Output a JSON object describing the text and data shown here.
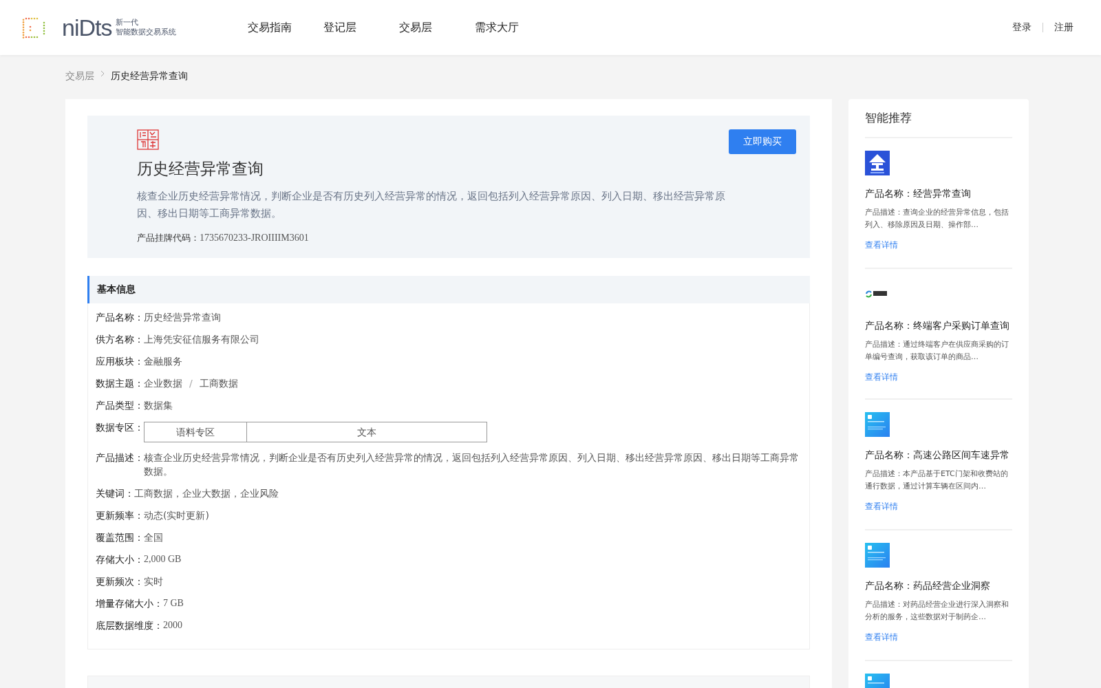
{
  "header": {
    "logo_text": "niDts",
    "logo_tagline": [
      "新一代",
      "智能数据交易系统"
    ],
    "nav": [
      {
        "label": "交易指南",
        "selected": false
      },
      {
        "label": "登记层",
        "selected": false
      },
      {
        "label": "交易层",
        "selected": false
      },
      {
        "label": "需求大厅",
        "selected": false
      }
    ],
    "auth": [
      "登录",
      "注册"
    ]
  },
  "breadcrumb": [
    "交易层",
    "历史经营异常查询"
  ],
  "product": {
    "title": "历史经营异常查询",
    "description": "核查企业历史经营异常情况，判断企业是否有历史列入经营异常的情况，返回包括列入经营异常原因、列入日期、移出经营异常原因、移出日期等工商异常数据。",
    "code_label": "产品挂牌代码：",
    "code": "1735670233-JROIIIIM3601",
    "buy_button": "立即购买"
  },
  "basic_info": {
    "title": "基本信息",
    "fields": [
      {
        "kind": "text",
        "label": "产品名称：",
        "value": "历史经营异常查询"
      },
      {
        "kind": "text",
        "label": "供方名称：",
        "value": "上海凭安征信服务有限公司"
      },
      {
        "kind": "text",
        "label": "应用板块：",
        "value": "金融服务"
      },
      {
        "kind": "path",
        "label": "数据主题：",
        "separator": "/",
        "values": [
          "企业数据",
          "工商数据"
        ]
      },
      {
        "kind": "text",
        "label": "产品类型：",
        "value": "数据集"
      },
      {
        "kind": "table",
        "label": "数据专区：",
        "values": [
          "语料专区",
          "文本"
        ]
      },
      {
        "kind": "text",
        "label": "产品描述：",
        "value": "核查企业历史经营异常情况，判断企业是否有历史列入经营异常的情况，返回包括列入经营异常原因、列入日期、移出经营异常原因、移出日期等工商异常数据。"
      },
      {
        "kind": "text",
        "label": "关键词：",
        "value": "工商数据，企业大数据，企业风险"
      },
      {
        "kind": "text",
        "label": "更新频率：",
        "value": "动态(实时更新)"
      },
      {
        "kind": "text",
        "label": "覆盖范围：",
        "value": "全国"
      },
      {
        "kind": "number",
        "label": "存储大小：",
        "value": "2,000 GB"
      },
      {
        "kind": "text",
        "label": "更新频次：",
        "value": "实时"
      },
      {
        "kind": "number",
        "label": "增量存储大小：",
        "value": "7 GB"
      },
      {
        "kind": "number",
        "label": "底层数据维度：",
        "value": "2000"
      }
    ]
  },
  "recommendations": {
    "title": "智能推荐",
    "items": [
      {
        "kind": "blue",
        "name": "产品名称：经营异常查询",
        "description": "产品描述：查询企业的经营异常信息，包括列入、移除原因及日期、操作部…",
        "link": "查看详情"
      },
      {
        "kind": "logo",
        "name": "产品名称：终端客户采购订单查询",
        "description": "产品描述：通过终端客户在供应商采购的订单编号查询，获取该订单的商品…",
        "link": "查看详情"
      },
      {
        "kind": "cyan",
        "name": "产品名称：高速公路区间车速异常",
        "description": "产品描述：本产品基于ETC门架和收费站的通行数据，通过计算车辆在区间内…",
        "link": "查看详情"
      },
      {
        "kind": "cyan",
        "name": "产品名称：药品经营企业洞察",
        "description": "产品描述：对药品经营企业进行深入洞察和分析的服务，这些数据对于制药企…",
        "link": "查看详情"
      },
      {
        "kind": "cyan"
      }
    ]
  }
}
